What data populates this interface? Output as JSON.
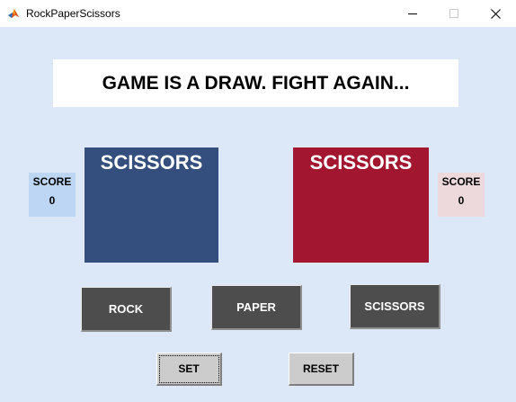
{
  "window": {
    "title": "RockPaperScissors",
    "icon": "matlab-icon"
  },
  "message": "GAME IS A DRAW. FIGHT AGAIN...",
  "player_left": {
    "score_label": "SCORE",
    "score_value": "0",
    "choice": "SCISSORS",
    "color": "#344e7d"
  },
  "player_right": {
    "score_label": "SCORE",
    "score_value": "0",
    "choice": "SCISSORS",
    "color": "#a3162f"
  },
  "buttons": {
    "rock": "ROCK",
    "paper": "PAPER",
    "scissors": "SCISSORS",
    "set": "SET",
    "reset": "RESET"
  },
  "colors": {
    "background": "#dce8f7",
    "button": "#4d4d4d",
    "control_button": "#cccccc"
  }
}
